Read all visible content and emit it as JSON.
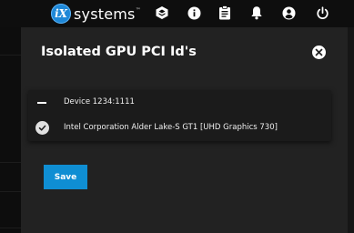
{
  "header": {
    "logo_mark": "iX",
    "logo_word": "systems",
    "logo_tm": "™",
    "icons": [
      "truecommand-icon",
      "info-icon",
      "tasks-icon",
      "bell-icon",
      "account-icon",
      "power-icon"
    ]
  },
  "dialog": {
    "title": "Isolated GPU PCI Id's",
    "close_icon": "close-icon",
    "options": [
      {
        "label": "Device 1234:1111",
        "selected": false
      },
      {
        "label": "Intel Corporation Alder Lake-S GT1 [UHD Graphics 730]",
        "selected": true
      }
    ],
    "save_label": "Save"
  },
  "colors": {
    "accent": "#0f8ed3",
    "logo_blue": "#1e88d8",
    "dialog_bg": "#222222",
    "list_bg": "#1b1b1b"
  }
}
